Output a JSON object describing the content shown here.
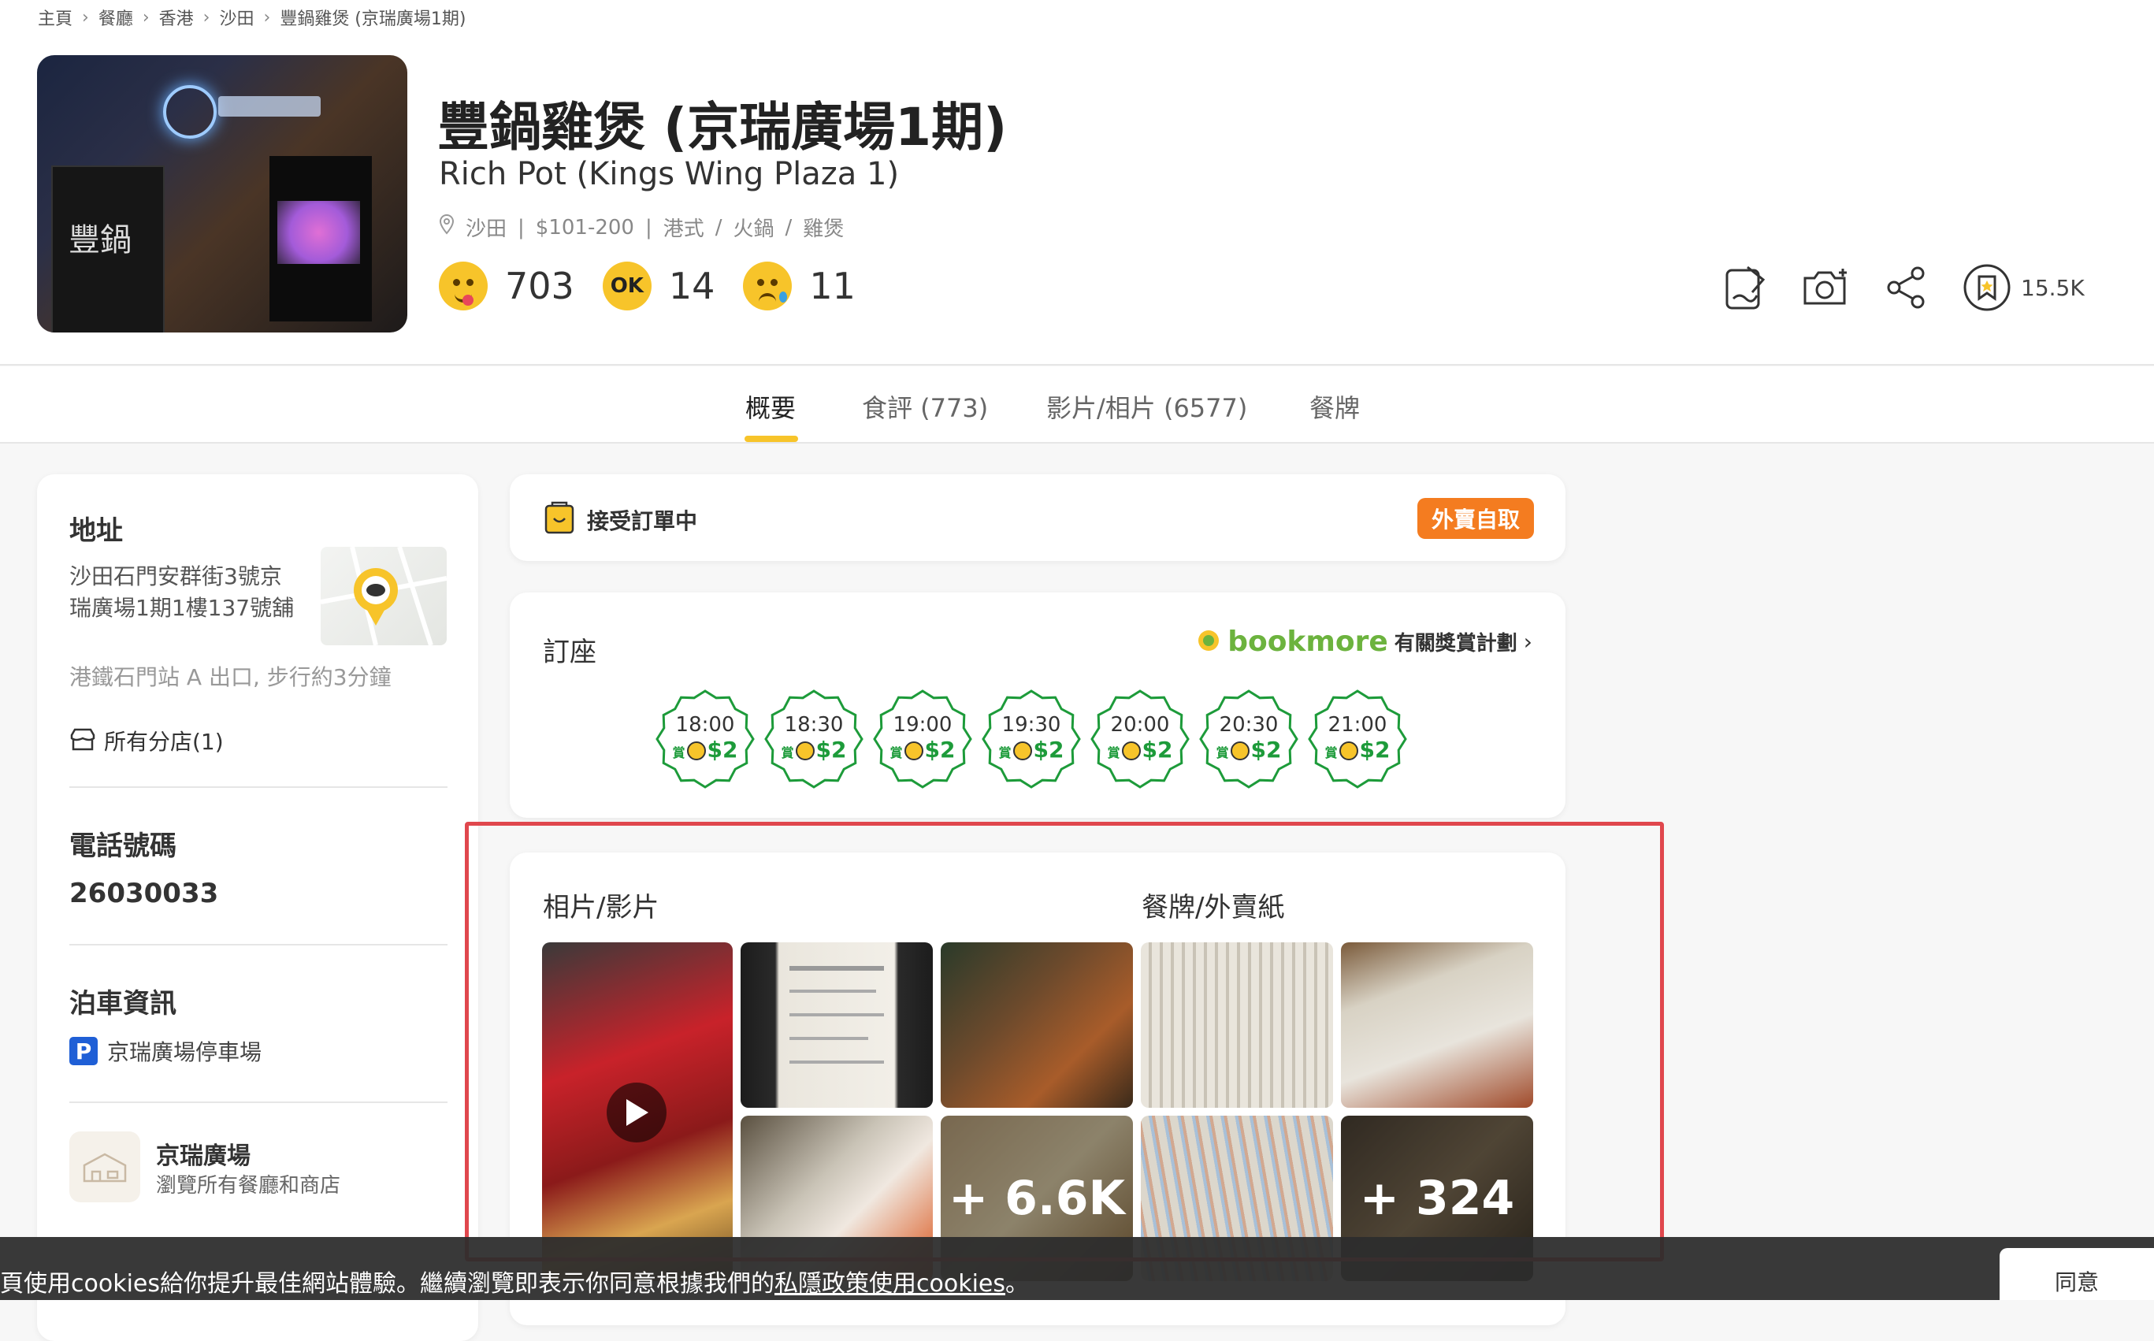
{
  "breadcrumb": [
    "主頁",
    "餐廳",
    "香港",
    "沙田",
    "豐鍋雞煲 (京瑞廣場1期)"
  ],
  "restaurant": {
    "name_zh": "豐鍋雞煲 (京瑞廣場1期)",
    "name_en": "Rich Pot (Kings Wing Plaza 1)",
    "district": "沙田",
    "price": "$101-200",
    "cuisine": [
      "港式",
      "火鍋",
      "雞煲"
    ],
    "poster_text": "豐鍋"
  },
  "ratings": {
    "smile": "703",
    "ok": "14",
    "cry": "11",
    "ok_label": "OK"
  },
  "actions": {
    "bookmark_count": "15.5K"
  },
  "tabs": [
    "概要",
    "食評 (773)",
    "影片/相片 (6577)",
    "餐牌"
  ],
  "info": {
    "address_title": "地址",
    "address_line1": "沙田石門安群街3號京",
    "address_line2": "瑞廣場1期1樓137號舖",
    "transport": "港鐵石門站 A 出口, 步行約3分鐘",
    "branches": "所有分店(1)",
    "phone_title": "電話號碼",
    "phone": "26030033",
    "parking_title": "泊車資訊",
    "parking": "京瑞廣場停車場",
    "mall_name": "京瑞廣場",
    "mall_desc": "瀏覽所有餐廳和商店"
  },
  "order": {
    "status": "接受訂單中",
    "badge": "外賣自取"
  },
  "booking": {
    "title": "訂座",
    "brand": "bookmore",
    "promo": "有關獎賞計劃",
    "reward_prefix": "賞",
    "slots": [
      {
        "time": "18:00",
        "reward": "$2"
      },
      {
        "time": "18:30",
        "reward": "$2"
      },
      {
        "time": "19:00",
        "reward": "$2"
      },
      {
        "time": "19:30",
        "reward": "$2"
      },
      {
        "time": "20:00",
        "reward": "$2"
      },
      {
        "time": "20:30",
        "reward": "$2"
      },
      {
        "time": "21:00",
        "reward": "$2"
      }
    ]
  },
  "media": {
    "photos_title": "相片/影片",
    "menus_title": "餐牌/外賣紙",
    "photos_more": "+ 6.6K",
    "menus_more": "+ 324"
  },
  "cookie": {
    "text_before": "頁使用cookies給你提升最佳網站體驗。繼續瀏覽即表示你同意根據我們的",
    "link": "私隱政策使用cookies",
    "text_after": "。",
    "agree": "同意"
  },
  "colors": {
    "accent": "#f7c42a",
    "orange": "#f47c20",
    "green": "#1d9b3a",
    "highlight": "#e0474d"
  }
}
